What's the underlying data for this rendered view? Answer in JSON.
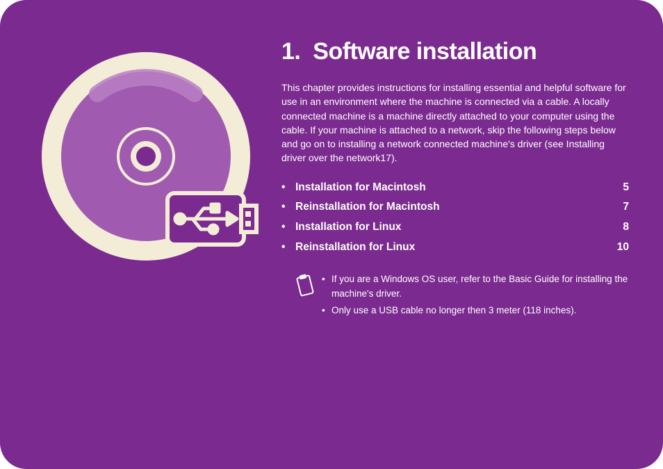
{
  "chapter": {
    "number": "1.",
    "title": "Software installation"
  },
  "intro": "This chapter provides instructions for installing essential and helpful software for use in an environment where the machine is connected via a cable. A locally connected machine is a machine directly attached to your computer using the cable. If your machine is attached to a network, skip the following steps below and go on to installing a network connected machine's driver (see Installing driver over the network17).",
  "toc": [
    {
      "label": "Installation for Macintosh",
      "page": "5"
    },
    {
      "label": "Reinstallation for Macintosh",
      "page": "7"
    },
    {
      "label": "Installation for Linux",
      "page": "8"
    },
    {
      "label": "Reinstallation for Linux",
      "page": "10"
    }
  ],
  "notes": [
    "If you are a Windows OS user, refer to the Basic Guide for installing the machine's driver.",
    "Only use a USB cable no longer then 3 meter (118 inches)."
  ],
  "bullet": "•"
}
